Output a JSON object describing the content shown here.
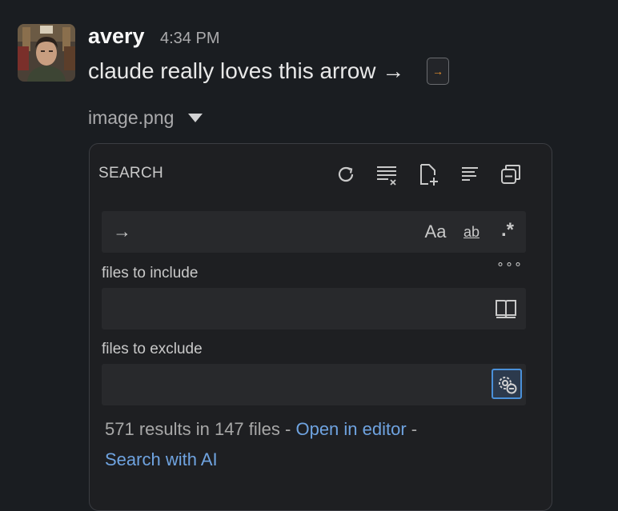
{
  "message": {
    "author": "avery",
    "timestamp": "4:34 PM",
    "text": "claude really loves this arrow →",
    "emoji_badge": "→"
  },
  "attachment": {
    "filename": "image.png",
    "screenshot": {
      "title": "SEARCH",
      "toolbar_icons": [
        "refresh-icon",
        "clear-results-icon",
        "new-search-editor-icon",
        "view-as-tree-icon",
        "collapse-all-icon"
      ],
      "search_value": "→",
      "search_toggles": {
        "match_case": "Aa",
        "whole_word": "ab",
        "regex": ".*"
      },
      "more_label": "∘∘∘",
      "include_label": "files to include",
      "include_value": "",
      "exclude_label": "files to exclude",
      "exclude_value": "",
      "results_text": "571 results in 147 files - ",
      "open_in_editor": "Open in editor",
      "separator": " -",
      "search_with_ai": "Search with AI"
    }
  },
  "colors": {
    "background": "#1a1d21",
    "link": "#6fa3e0",
    "emoji_arrow": "#e8912d",
    "active_toggle_border": "#4a90d9"
  }
}
